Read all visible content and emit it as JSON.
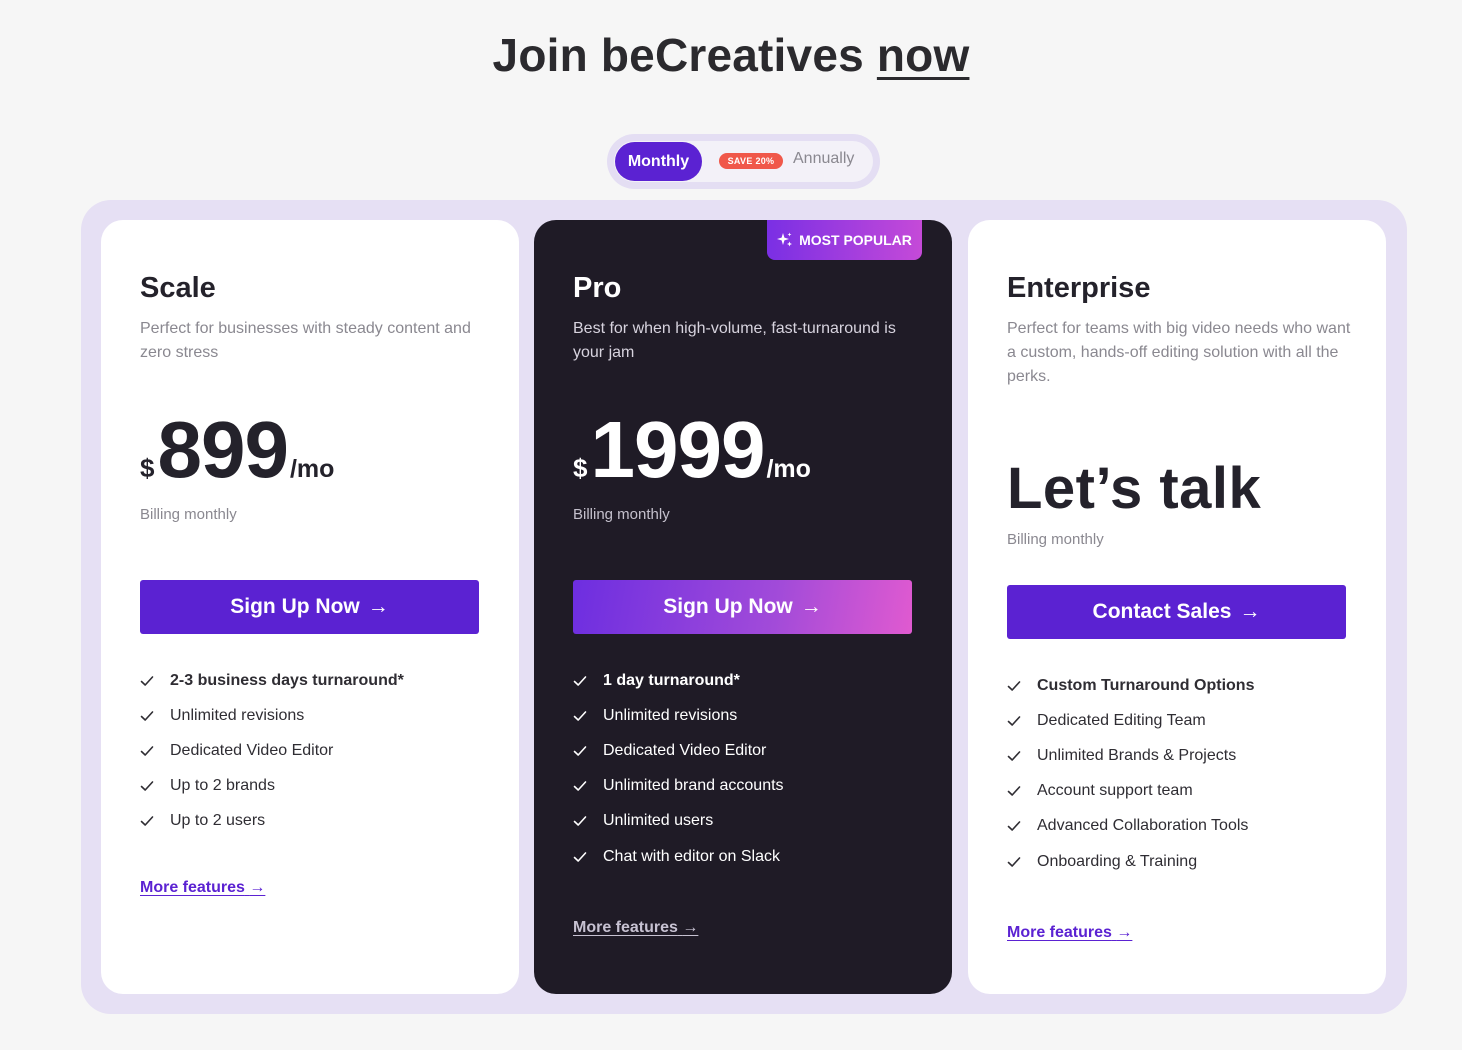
{
  "header": {
    "title_main": "Join beCreatives",
    "title_emphasis": "now"
  },
  "billing_toggle": {
    "monthly_label": "Monthly",
    "save_badge": "SAVE 20%",
    "annually_label": "Annually",
    "selected": "Monthly"
  },
  "colors": {
    "accent": "#5b22d2",
    "pro_card_bg": "#1f1b26",
    "panel_bg": "#e6e0f4",
    "badge_red": "#f0584a"
  },
  "plans": [
    {
      "name": "Scale",
      "description": "Perfect for businesses with steady content and zero stress",
      "currency": "$",
      "price": "899",
      "period": "/mo",
      "billing_note": "Billing monthly",
      "cta_label": "Sign Up Now",
      "features": [
        "2-3 business days turnaround*",
        "Unlimited revisions",
        "Dedicated Video Editor",
        "Up to 2 brands",
        "Up to 2 users"
      ],
      "more_label": "More features"
    },
    {
      "name": "Pro",
      "badge": "MOST POPULAR",
      "description": "Best for when high-volume, fast-turnaround is your jam",
      "currency": "$",
      "price": "1999",
      "period": "/mo",
      "billing_note": "Billing monthly",
      "cta_label": "Sign Up Now",
      "features": [
        "1 day turnaround*",
        "Unlimited revisions",
        "Dedicated Video Editor",
        "Unlimited brand accounts",
        "Unlimited users",
        "Chat with editor on Slack"
      ],
      "more_label": "More features"
    },
    {
      "name": "Enterprise",
      "description": "Perfect for teams with big video needs who want a custom, hands-off editing solution with all the perks.",
      "price_text": "Let’s talk",
      "billing_note": "Billing monthly",
      "cta_label": "Contact Sales",
      "features": [
        "Custom Turnaround Options",
        "Dedicated Editing Team",
        "Unlimited Brands & Projects",
        "Account support team",
        "Advanced Collaboration Tools",
        "Onboarding & Training"
      ],
      "more_label": "More features"
    }
  ]
}
